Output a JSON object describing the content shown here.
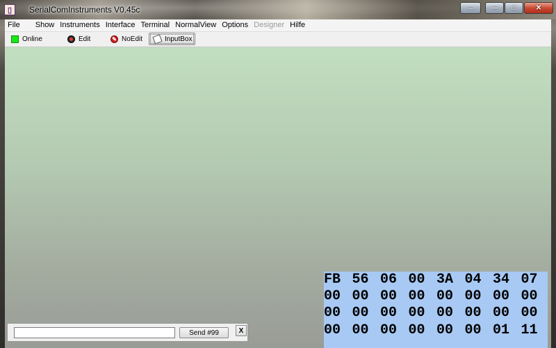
{
  "window": {
    "title": "SerialComInstruments  V0.45c",
    "app_icon_glyph": "▯",
    "caption_buttons": {
      "restore": "↔",
      "minimize": "—",
      "maximize": "□",
      "close": "✕"
    }
  },
  "menu": [
    {
      "label": "File",
      "disabled": false
    },
    {
      "label": "Show",
      "disabled": false
    },
    {
      "label": "Instruments",
      "disabled": false
    },
    {
      "label": "Interface",
      "disabled": false
    },
    {
      "label": "Terminal",
      "disabled": false
    },
    {
      "label": "NormalView",
      "disabled": false
    },
    {
      "label": "Options",
      "disabled": false
    },
    {
      "label": "Designer",
      "disabled": true
    },
    {
      "label": "Hilfe",
      "disabled": false
    }
  ],
  "toolbar": {
    "online": {
      "label": "Online",
      "icon": "green-status-led",
      "color": "#19e619"
    },
    "edit": {
      "label": "Edit",
      "icon": "edit-icon"
    },
    "noedit": {
      "label": "NoEdit",
      "icon": "no-edit-icon"
    },
    "inputbox": {
      "label": "InputBox",
      "icon": "inputbox-icon"
    }
  },
  "inputbox": {
    "value": "",
    "send_label": "Send #99",
    "close_label": "X"
  },
  "hex_view": {
    "rows": [
      [
        "FB",
        "56",
        "06",
        "00",
        "3A",
        "04",
        "34",
        "07"
      ],
      [
        "00",
        "00",
        "00",
        "00",
        "00",
        "00",
        "00",
        "00"
      ],
      [
        "00",
        "00",
        "00",
        "00",
        "00",
        "00",
        "00",
        "00"
      ],
      [
        "00",
        "00",
        "00",
        "00",
        "00",
        "00",
        "01",
        "11"
      ]
    ]
  },
  "colors": {
    "canvas_top": "#c2dfc1",
    "canvas_bottom": "#999c96",
    "hex_background": "#a8c9f4"
  }
}
